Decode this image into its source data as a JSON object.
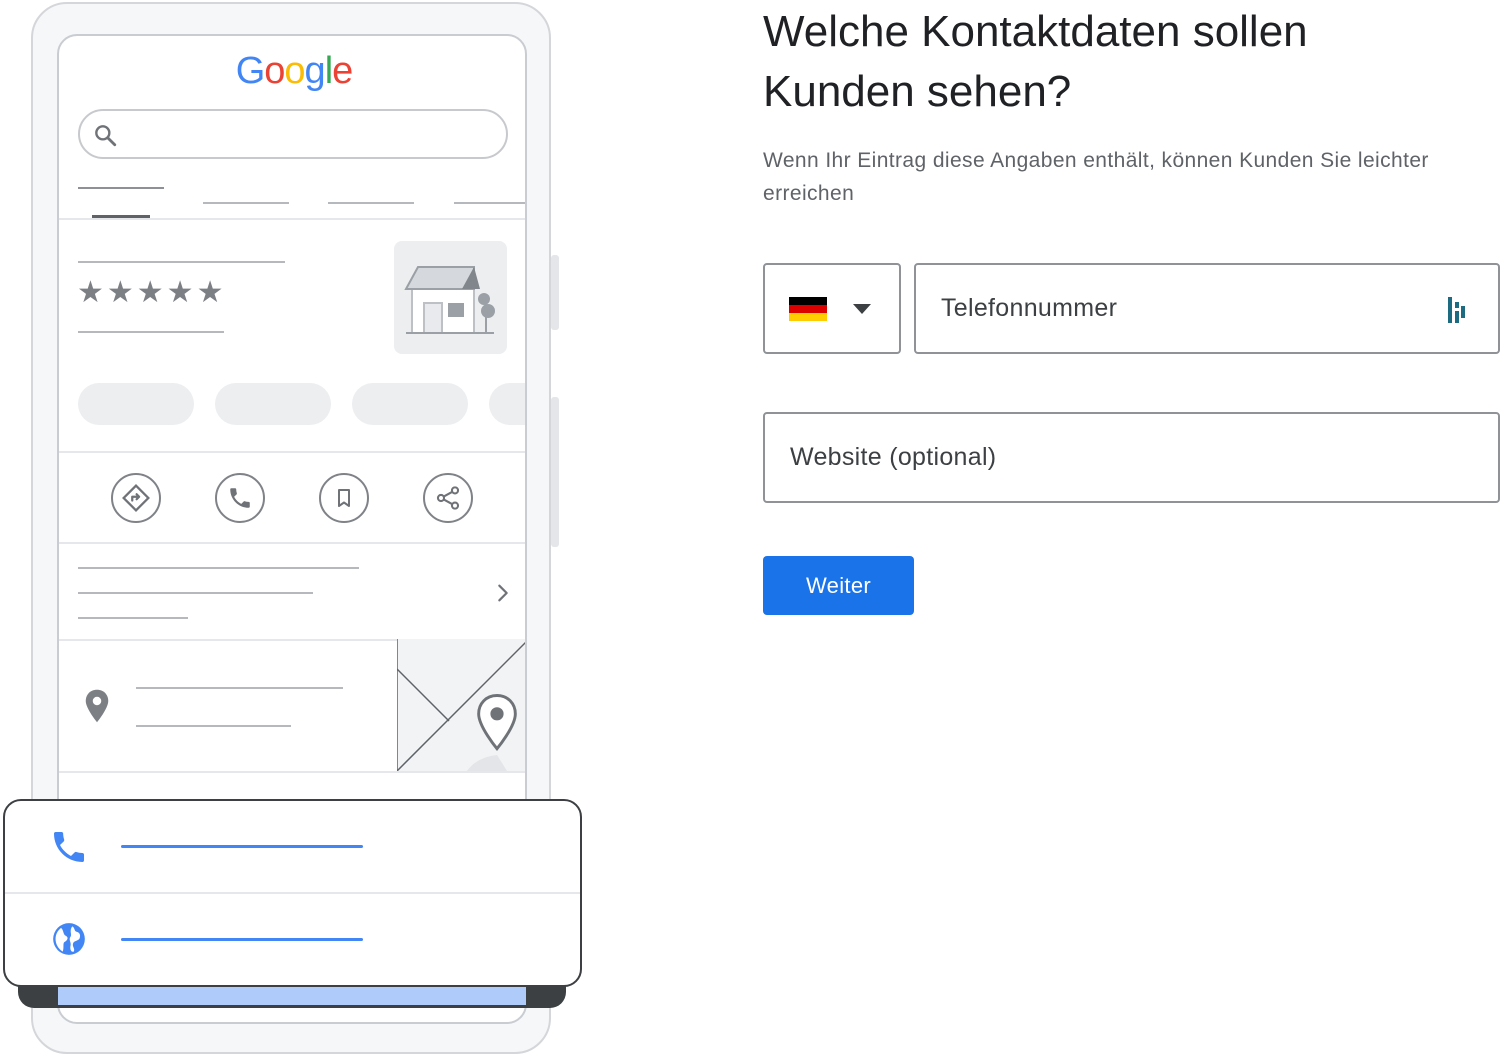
{
  "phone_mockup": {
    "logo_text": "Google",
    "logo_colors": [
      "#4285F4",
      "#EA4335",
      "#FBBC05",
      "#4285F4",
      "#34A853",
      "#EA4335"
    ],
    "rating_stars": "★★★★★",
    "icons": {
      "search": "search-icon",
      "directions": "directions-icon",
      "call": "phone-icon",
      "save": "bookmark-icon",
      "share": "share-icon",
      "chevron": "chevron-right-icon",
      "location": "location-pin-icon",
      "map_marker": "map-marker-icon",
      "store": "storefront-icon"
    }
  },
  "popup_card": {
    "phone_icon": "phone-icon",
    "website_icon": "globe-icon",
    "accent_color": "#4285F4"
  },
  "form": {
    "heading": "Welche Kontaktdaten sollen Kunden sehen?",
    "subtext": "Wenn Ihr Eintrag diese Angaben enthält, können Kunden Sie leichter erreichen",
    "country_selector": {
      "flag": "germany-flag",
      "arrow": "dropdown-arrow-icon"
    },
    "phone_placeholder": "Telefonnummer",
    "phone_addon_icon": "password-manager-icon",
    "website_placeholder": "Website (optional)",
    "submit_label": "Weiter",
    "accent_color": "#1A73E8"
  }
}
